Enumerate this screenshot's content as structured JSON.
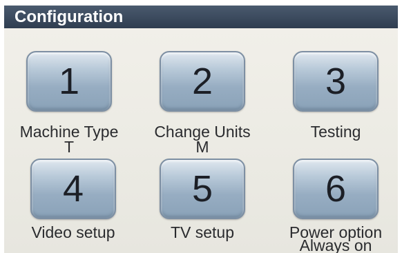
{
  "window": {
    "title": "Configuration"
  },
  "buttons": [
    {
      "number": "1",
      "label": "Machine Type",
      "value": "T"
    },
    {
      "number": "2",
      "label": "Change Units",
      "value": "M"
    },
    {
      "number": "3",
      "label": "Testing",
      "value": ""
    },
    {
      "number": "4",
      "label": "Video setup",
      "value": ""
    },
    {
      "number": "5",
      "label": "TV setup",
      "value": ""
    },
    {
      "number": "6",
      "label": "Power option",
      "value": "Always on"
    }
  ],
  "colors": {
    "titlebar": "#2f3d50",
    "button_face": "#97adc2",
    "background": "#ecebe4"
  }
}
